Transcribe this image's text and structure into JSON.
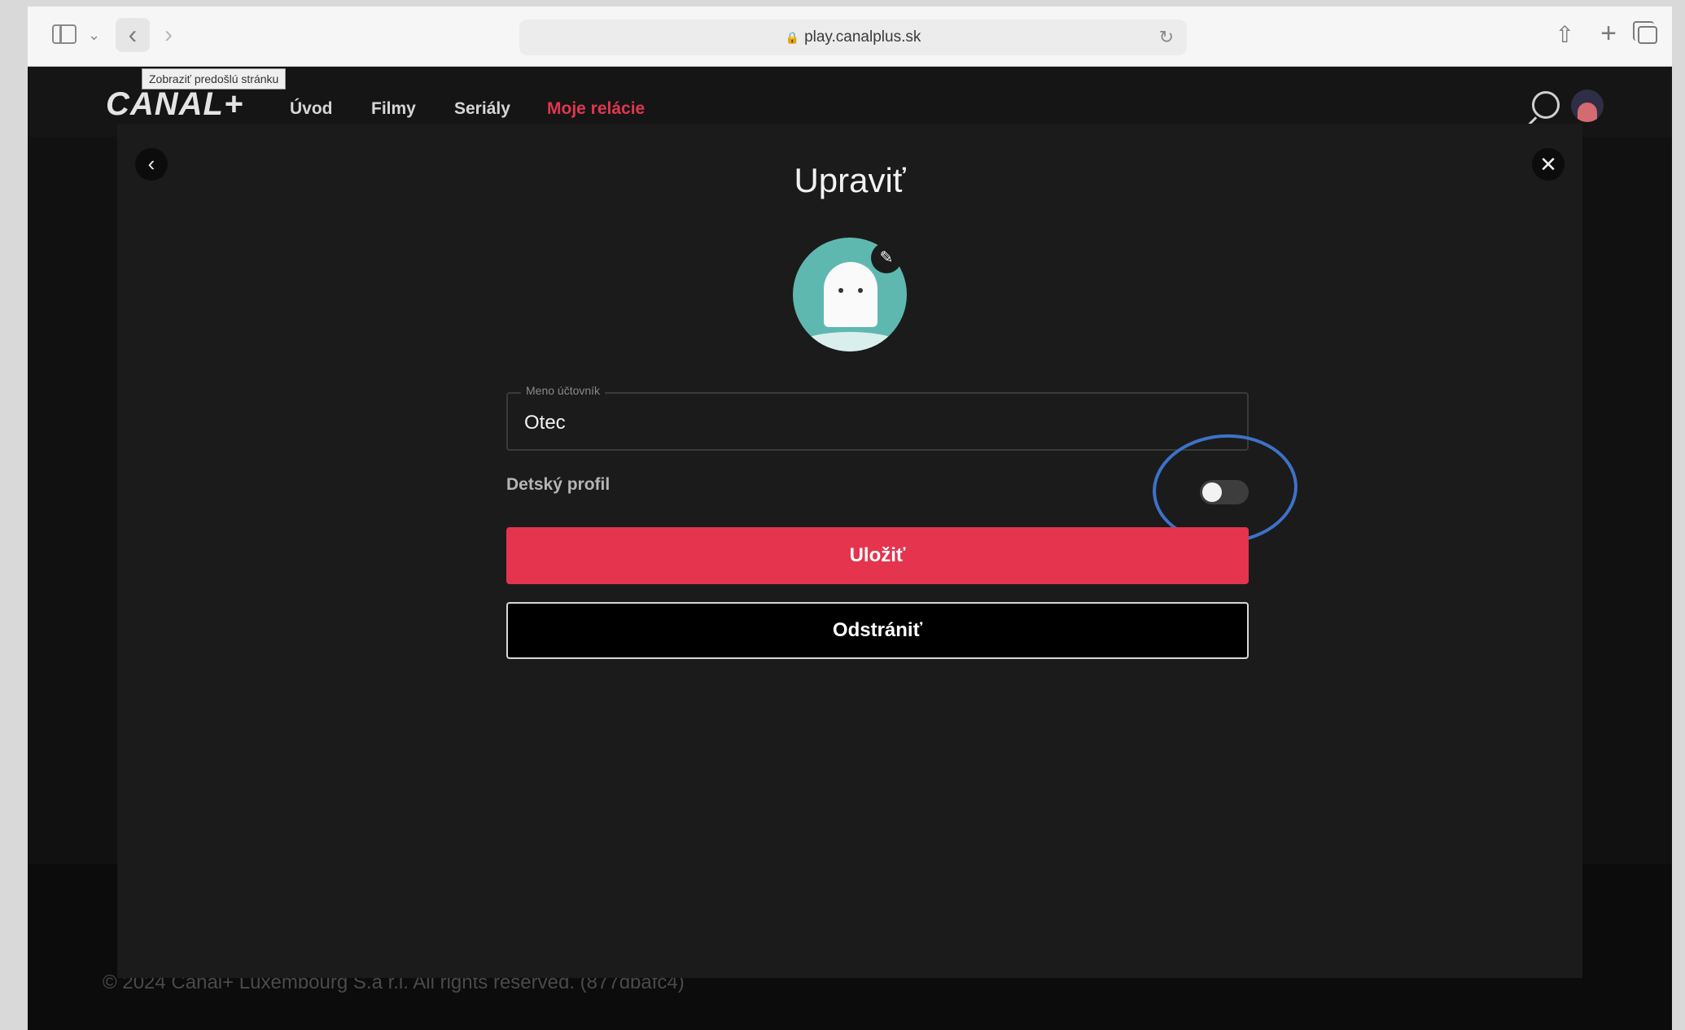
{
  "browser": {
    "url": "play.canalplus.sk",
    "back_glyph": "‹",
    "forward_glyph": "›",
    "tooltip": "Zobraziť predošlú stránku"
  },
  "header": {
    "logo": "CANAL+",
    "nav": [
      {
        "label": "Úvod",
        "active": false
      },
      {
        "label": "Filmy",
        "active": false
      },
      {
        "label": "Seriály",
        "active": false
      },
      {
        "label": "Moje relácie",
        "active": true
      }
    ]
  },
  "background": {
    "footer_copyright": "© 2024 Canal+ Luxembourg S.à r.l. All rights reserved. (877dbafc4)"
  },
  "modal": {
    "title": "Upraviť",
    "name_field": {
      "label": "Meno účtovník",
      "value": "Otec"
    },
    "kids_profile_label": "Detský profil",
    "kids_profile_enabled": false,
    "save_label": "Uložiť",
    "delete_label": "Odstrániť"
  },
  "colors": {
    "accent": "#e4344e",
    "annotation": "#3d72c8",
    "avatar_bg": "#5fb8b0"
  }
}
